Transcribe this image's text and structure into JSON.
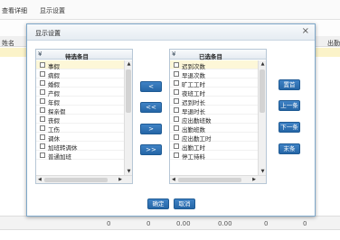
{
  "topbar": {
    "link_view_detail": "查看详细",
    "link_display_settings": "显示设置"
  },
  "background": {
    "left_col_header": "姓名",
    "right_col_header": "出勤",
    "footer_values": [
      "0",
      "0",
      "0.00",
      "0.00",
      "0",
      "0"
    ]
  },
  "dialog": {
    "title": "显示设置",
    "close": "×",
    "left_panel": {
      "header": "待选条目",
      "items": [
        {
          "label": "事假",
          "selected": true
        },
        {
          "label": "病假"
        },
        {
          "label": "婚假"
        },
        {
          "label": "产假"
        },
        {
          "label": "年假"
        },
        {
          "label": "探亲假"
        },
        {
          "label": "丧假"
        },
        {
          "label": "工伤"
        },
        {
          "label": "调休"
        },
        {
          "label": "加班转调休"
        },
        {
          "label": "普通加班"
        }
      ]
    },
    "right_panel": {
      "header": "已选条目",
      "items": [
        {
          "label": "迟到次数",
          "selected": true
        },
        {
          "label": "早退次数"
        },
        {
          "label": "旷工工时"
        },
        {
          "label": "夜班工时"
        },
        {
          "label": "迟到时长"
        },
        {
          "label": "早退时长"
        },
        {
          "label": "应出勤班数"
        },
        {
          "label": "出勤班数"
        },
        {
          "label": "应出勤工时"
        },
        {
          "label": "出勤工时"
        },
        {
          "label": "停工待料"
        }
      ]
    },
    "mid_buttons": {
      "move_left": "<",
      "move_all_left": "<<",
      "move_right": ">",
      "move_all_right": ">>"
    },
    "order_buttons": {
      "top": "置首",
      "up": "上一条",
      "down": "下一条",
      "bottom": "末条"
    },
    "ok": "确定",
    "cancel": "取消"
  },
  "colors": {
    "button_blue": "#2f74b8",
    "selected_row": "#fdf7d8",
    "title_bar": "#e6ecf2"
  }
}
